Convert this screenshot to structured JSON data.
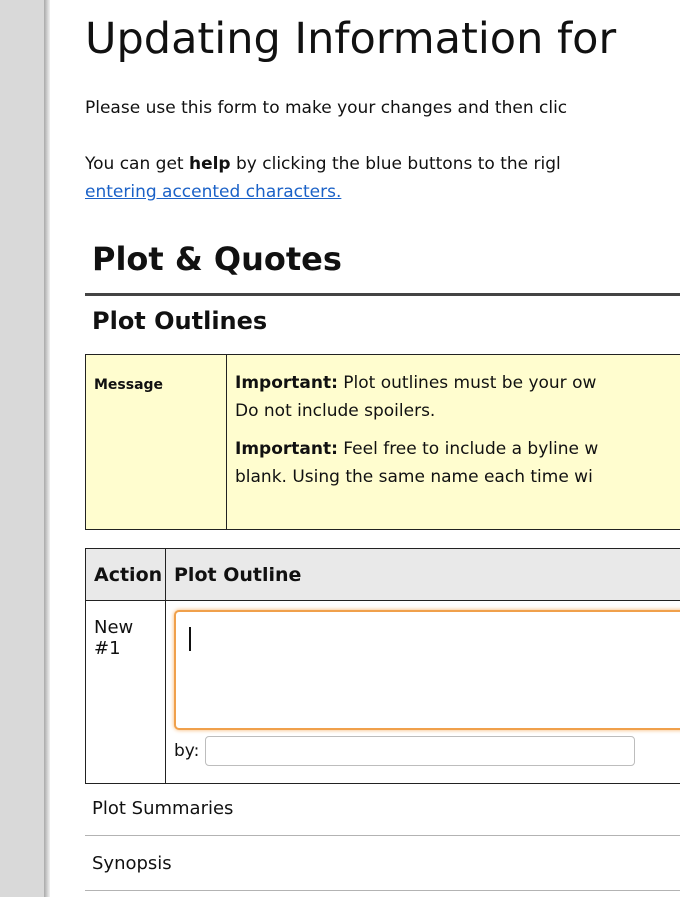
{
  "page": {
    "title": "Updating Information for",
    "intro_line_1": "Please use this form to make your changes and then clic",
    "intro_line_2_pre": "You can get ",
    "intro_line_2_bold": "help",
    "intro_line_2_post": " by clicking the blue buttons to the rigl",
    "accent_link": "entering accented characters."
  },
  "section": {
    "title": "Plot & Quotes",
    "subsection_title": "Plot Outlines"
  },
  "message_box": {
    "label": "Message",
    "para1_bold": "Important:",
    "para1_line1": " Plot outlines must be your ow",
    "para1_line2": "Do not include spoilers.",
    "para2_bold": "Important:",
    "para2_line1": " Feel free to include a byline w",
    "para2_line2": "blank. Using the same name each time wi"
  },
  "plot_table": {
    "headers": [
      "Action",
      "Plot Outline"
    ],
    "row": {
      "action": "New #1",
      "outline_value": "",
      "by_label": "by:",
      "by_value": ""
    }
  },
  "collapsed_sections": [
    "Plot Summaries",
    "Synopsis"
  ],
  "colors": {
    "link": "#1a61c7",
    "message_bg": "#fffdcf",
    "focus_border": "#f0a04b",
    "header_bg": "#e9e9e9"
  }
}
